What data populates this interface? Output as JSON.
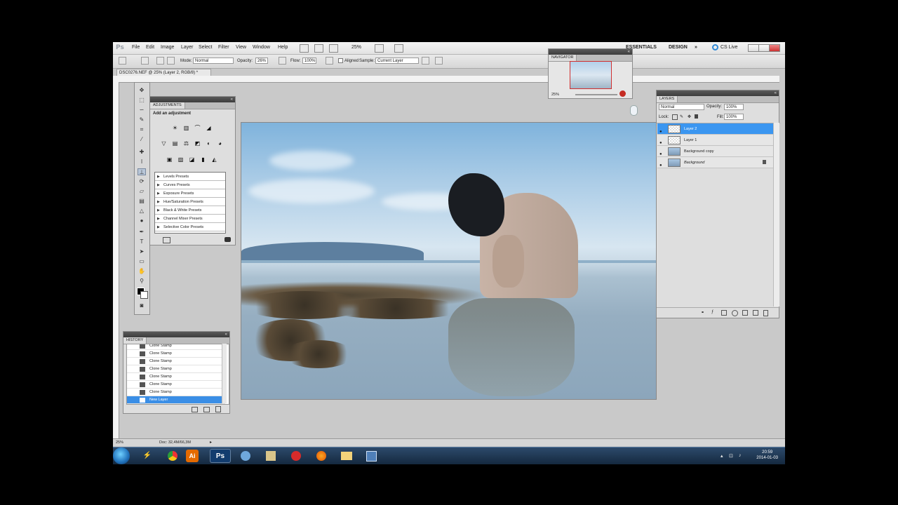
{
  "app": {
    "logo": "Ps"
  },
  "menu": [
    "File",
    "Edit",
    "Image",
    "Layer",
    "Select",
    "Filter",
    "View",
    "Window",
    "Help"
  ],
  "menubar_right": {
    "zoom": "25%",
    "workspace_1": "ESSENTIALS",
    "workspace_2": "DESIGN",
    "more": "»",
    "cs_live": "CS Live"
  },
  "options": {
    "mode_label": "Mode:",
    "mode_value": "Normal",
    "opacity_label": "Opacity:",
    "opacity_value": "26%",
    "flow_label": "Flow:",
    "flow_value": "100%",
    "aligned_label": "Aligned",
    "sample_label": "Sample:",
    "sample_value": "Current Layer"
  },
  "document": {
    "tab": "DSC0276.NEF @ 25% (Layer 2, RGB/8) *",
    "status_zoom": "25%",
    "status_doc": "Doc: 32,4M/66,3M"
  },
  "adjustments": {
    "tab": "ADJUSTMENTS",
    "heading": "Add an adjustment",
    "presets": [
      "Levels Presets",
      "Curves Presets",
      "Exposure Presets",
      "Hue/Saturation Presets",
      "Black & White Presets",
      "Channel Mixer Presets",
      "Selective Color Presets"
    ]
  },
  "history": {
    "tab": "HISTORY",
    "items": [
      "Clone Stamp",
      "Clone Stamp",
      "Clone Stamp",
      "Clone Stamp",
      "Clone Stamp",
      "Clone Stamp",
      "Clone Stamp",
      "New Layer"
    ]
  },
  "navigator": {
    "tab": "NAVIGATOR",
    "zoom": "25%"
  },
  "layers": {
    "tab": "LAYERS",
    "blend": "Normal",
    "opacity_label": "Opacity:",
    "opacity_value": "100%",
    "lock_label": "Lock:",
    "fill_label": "Fill:",
    "fill_value": "100%",
    "items": [
      "Layer 2",
      "Layer 1",
      "Background copy",
      "Background"
    ]
  },
  "taskbar": {
    "time": "20:59",
    "date": "2014-01-03"
  },
  "icons": [
    "move-icon",
    "marquee-icon",
    "lasso-icon",
    "quick-select-icon",
    "crop-icon",
    "eyedropper-icon",
    "healing-icon",
    "brush-icon",
    "clone-stamp-icon",
    "history-brush-icon",
    "eraser-icon",
    "gradient-icon",
    "blur-icon",
    "dodge-icon",
    "pen-icon",
    "type-icon",
    "path-select-icon",
    "shape-icon",
    "hand-icon",
    "zoom-icon"
  ]
}
